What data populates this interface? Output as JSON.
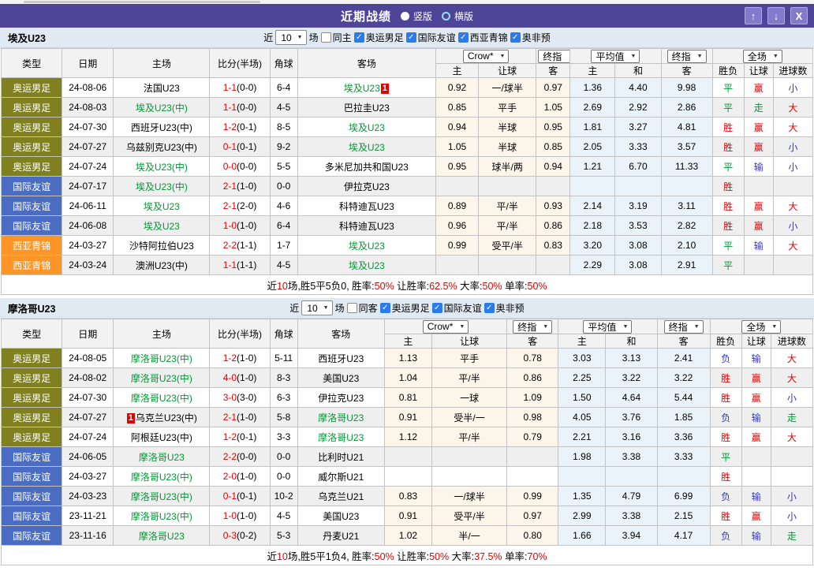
{
  "colors": {
    "titlebar_bg": "#4e4498",
    "button_bg": "#837acb",
    "section_bar_bg": "#e1eaf3",
    "team_green": "#009933",
    "score_red": "#e60000",
    "odds_bg": "#fcf5ea",
    "avg_bg": "#e9f3f9",
    "stripe_bg": "#efefef",
    "checkbox_blue": "#2b7cea",
    "type_colors": {
      "奥运男足": "#80801e",
      "国际友谊": "#4a6cc3",
      "西亚青锦": "#fd9627"
    },
    "result_colors": {
      "red": "#e60000",
      "green": "#009933",
      "blue": "#3434d0"
    }
  },
  "titlebar": {
    "title": "近期战绩",
    "vertical_label": "竖版",
    "horizontal_label": "横版",
    "up_button": "↑",
    "down_button": "↓",
    "close_button": "X"
  },
  "table_header": {
    "type": "类型",
    "date": "日期",
    "home": "主场",
    "score": "比分(半场)",
    "corner": "角球",
    "away": "客场",
    "odds_source": "Crow*",
    "odds_final": "终指",
    "avg_source": "平均值",
    "avg_final": "终指",
    "scope": "全场",
    "sub": [
      "主",
      "让球",
      "客",
      "主",
      "和",
      "客",
      "胜负",
      "让球",
      "进球数"
    ]
  },
  "result_color_map": {
    "胜": "red",
    "负": "blue",
    "平": "green",
    "赢": "red",
    "输": "blue",
    "走": "green",
    "大": "red",
    "小": "blue"
  },
  "sections": [
    {
      "team": "埃及U23",
      "filter": {
        "near": "近",
        "count": "10",
        "games": "场",
        "same_side": {
          "label": "同主",
          "checked": false
        },
        "competitions": [
          {
            "label": "奥运男足",
            "checked": true
          },
          {
            "label": "国际友谊",
            "checked": true
          },
          {
            "label": "西亚青锦",
            "checked": true
          },
          {
            "label": "奥非预",
            "checked": true
          }
        ]
      },
      "rows": [
        {
          "type": "奥运男足",
          "date": "24-08-06",
          "home": "法国U23",
          "home_green": false,
          "home_badge": "",
          "score": "1-1",
          "half": "(0-0)",
          "corner": "6-4",
          "away": "埃及U23",
          "away_green": true,
          "away_badge": "1",
          "odds": [
            "0.92",
            "一/球半",
            "0.97"
          ],
          "avg": [
            "1.36",
            "4.40",
            "9.98"
          ],
          "results": [
            "平",
            "赢",
            "小"
          ]
        },
        {
          "type": "奥运男足",
          "date": "24-08-03",
          "home": "埃及U23(中)",
          "home_green": true,
          "home_badge": "",
          "score": "1-1",
          "half": "(0-0)",
          "corner": "4-5",
          "away": "巴拉圭U23",
          "away_green": false,
          "away_badge": "",
          "odds": [
            "0.85",
            "平手",
            "1.05"
          ],
          "avg": [
            "2.69",
            "2.92",
            "2.86"
          ],
          "results": [
            "平",
            "走",
            "大"
          ]
        },
        {
          "type": "奥运男足",
          "date": "24-07-30",
          "home": "西班牙U23(中)",
          "home_green": false,
          "home_badge": "",
          "score": "1-2",
          "half": "(0-1)",
          "corner": "8-5",
          "away": "埃及U23",
          "away_green": true,
          "away_badge": "",
          "odds": [
            "0.94",
            "半球",
            "0.95"
          ],
          "avg": [
            "1.81",
            "3.27",
            "4.81"
          ],
          "results": [
            "胜",
            "赢",
            "大"
          ]
        },
        {
          "type": "奥运男足",
          "date": "24-07-27",
          "home": "乌兹别克U23(中)",
          "home_green": false,
          "home_badge": "",
          "score": "0-1",
          "half": "(0-1)",
          "corner": "9-2",
          "away": "埃及U23",
          "away_green": true,
          "away_badge": "",
          "odds": [
            "1.05",
            "半球",
            "0.85"
          ],
          "avg": [
            "2.05",
            "3.33",
            "3.57"
          ],
          "results": [
            "胜",
            "赢",
            "小"
          ]
        },
        {
          "type": "奥运男足",
          "date": "24-07-24",
          "home": "埃及U23(中)",
          "home_green": true,
          "home_badge": "",
          "score": "0-0",
          "half": "(0-0)",
          "corner": "5-5",
          "away": "多米尼加共和国U23",
          "away_green": false,
          "away_badge": "",
          "odds": [
            "0.95",
            "球半/两",
            "0.94"
          ],
          "avg": [
            "1.21",
            "6.70",
            "11.33"
          ],
          "results": [
            "平",
            "输",
            "小"
          ]
        },
        {
          "type": "国际友谊",
          "date": "24-07-17",
          "home": "埃及U23(中)",
          "home_green": true,
          "home_badge": "",
          "score": "2-1",
          "half": "(1-0)",
          "corner": "0-0",
          "away": "伊拉克U23",
          "away_green": false,
          "away_badge": "",
          "odds": [
            "",
            "",
            ""
          ],
          "avg": [
            "",
            "",
            ""
          ],
          "results": [
            "胜",
            "",
            ""
          ]
        },
        {
          "type": "国际友谊",
          "date": "24-06-11",
          "home": "埃及U23",
          "home_green": true,
          "home_badge": "",
          "score": "2-1",
          "half": "(2-0)",
          "corner": "4-6",
          "away": "科特迪瓦U23",
          "away_green": false,
          "away_badge": "",
          "odds": [
            "0.89",
            "平/半",
            "0.93"
          ],
          "avg": [
            "2.14",
            "3.19",
            "3.11"
          ],
          "results": [
            "胜",
            "赢",
            "大"
          ]
        },
        {
          "type": "国际友谊",
          "date": "24-06-08",
          "home": "埃及U23",
          "home_green": true,
          "home_badge": "",
          "score": "1-0",
          "half": "(1-0)",
          "corner": "6-4",
          "away": "科特迪瓦U23",
          "away_green": false,
          "away_badge": "",
          "odds": [
            "0.96",
            "平/半",
            "0.86"
          ],
          "avg": [
            "2.18",
            "3.53",
            "2.82"
          ],
          "results": [
            "胜",
            "赢",
            "小"
          ]
        },
        {
          "type": "西亚青锦",
          "date": "24-03-27",
          "home": "沙特阿拉伯U23",
          "home_green": false,
          "home_badge": "",
          "score": "2-2",
          "half": "(1-1)",
          "corner": "1-7",
          "away": "埃及U23",
          "away_green": true,
          "away_badge": "",
          "odds": [
            "0.99",
            "受平/半",
            "0.83"
          ],
          "avg": [
            "3.20",
            "3.08",
            "2.10"
          ],
          "results": [
            "平",
            "输",
            "大"
          ]
        },
        {
          "type": "西亚青锦",
          "date": "24-03-24",
          "home": "澳洲U23(中)",
          "home_green": false,
          "home_badge": "",
          "score": "1-1",
          "half": "(1-1)",
          "corner": "4-5",
          "away": "埃及U23",
          "away_green": true,
          "away_badge": "",
          "odds": [
            "",
            "",
            ""
          ],
          "avg": [
            "2.29",
            "3.08",
            "2.91"
          ],
          "results": [
            "平",
            "",
            ""
          ]
        }
      ],
      "summary": [
        {
          "t": "近",
          "red": false
        },
        {
          "t": "10",
          "red": true
        },
        {
          "t": "场,胜5平5负0, 胜率:",
          "red": false
        },
        {
          "t": "50%",
          "red": true
        },
        {
          "t": " 让胜率:",
          "red": false
        },
        {
          "t": "62.5%",
          "red": true
        },
        {
          "t": " 大率:",
          "red": false
        },
        {
          "t": "50%",
          "red": true
        },
        {
          "t": " 单率:",
          "red": false
        },
        {
          "t": "50%",
          "red": true
        }
      ]
    },
    {
      "team": "摩洛哥U23",
      "filter": {
        "near": "近",
        "count": "10",
        "games": "场",
        "same_side": {
          "label": "同客",
          "checked": false
        },
        "competitions": [
          {
            "label": "奥运男足",
            "checked": true
          },
          {
            "label": "国际友谊",
            "checked": true
          },
          {
            "label": "奥非预",
            "checked": true
          }
        ]
      },
      "rows": [
        {
          "type": "奥运男足",
          "date": "24-08-05",
          "home": "摩洛哥U23(中)",
          "home_green": true,
          "home_badge": "",
          "score": "1-2",
          "half": "(1-0)",
          "corner": "5-11",
          "away": "西班牙U23",
          "away_green": false,
          "away_badge": "",
          "odds": [
            "1.13",
            "平手",
            "0.78"
          ],
          "avg": [
            "3.03",
            "3.13",
            "2.41"
          ],
          "results": [
            "负",
            "输",
            "大"
          ]
        },
        {
          "type": "奥运男足",
          "date": "24-08-02",
          "home": "摩洛哥U23(中)",
          "home_green": true,
          "home_badge": "",
          "score": "4-0",
          "half": "(1-0)",
          "corner": "8-3",
          "away": "美国U23",
          "away_green": false,
          "away_badge": "",
          "odds": [
            "1.04",
            "平/半",
            "0.86"
          ],
          "avg": [
            "2.25",
            "3.22",
            "3.22"
          ],
          "results": [
            "胜",
            "赢",
            "大"
          ]
        },
        {
          "type": "奥运男足",
          "date": "24-07-30",
          "home": "摩洛哥U23(中)",
          "home_green": true,
          "home_badge": "",
          "score": "3-0",
          "half": "(3-0)",
          "corner": "6-3",
          "away": "伊拉克U23",
          "away_green": false,
          "away_badge": "",
          "odds": [
            "0.81",
            "一球",
            "1.09"
          ],
          "avg": [
            "1.50",
            "4.64",
            "5.44"
          ],
          "results": [
            "胜",
            "赢",
            "小"
          ]
        },
        {
          "type": "奥运男足",
          "date": "24-07-27",
          "home": "乌克兰U23(中)",
          "home_green": false,
          "home_badge": "1",
          "score": "2-1",
          "half": "(1-0)",
          "corner": "5-8",
          "away": "摩洛哥U23",
          "away_green": true,
          "away_badge": "",
          "odds": [
            "0.91",
            "受半/一",
            "0.98"
          ],
          "avg": [
            "4.05",
            "3.76",
            "1.85"
          ],
          "results": [
            "负",
            "输",
            "走"
          ]
        },
        {
          "type": "奥运男足",
          "date": "24-07-24",
          "home": "阿根廷U23(中)",
          "home_green": false,
          "home_badge": "",
          "score": "1-2",
          "half": "(0-1)",
          "corner": "3-3",
          "away": "摩洛哥U23",
          "away_green": true,
          "away_badge": "",
          "odds": [
            "1.12",
            "平/半",
            "0.79"
          ],
          "avg": [
            "2.21",
            "3.16",
            "3.36"
          ],
          "results": [
            "胜",
            "赢",
            "大"
          ]
        },
        {
          "type": "国际友谊",
          "date": "24-06-05",
          "home": "摩洛哥U23",
          "home_green": true,
          "home_badge": "",
          "score": "2-2",
          "half": "(0-0)",
          "corner": "0-0",
          "away": "比利时U21",
          "away_green": false,
          "away_badge": "",
          "odds": [
            "",
            "",
            ""
          ],
          "avg": [
            "1.98",
            "3.38",
            "3.33"
          ],
          "results": [
            "平",
            "",
            ""
          ]
        },
        {
          "type": "国际友谊",
          "date": "24-03-27",
          "home": "摩洛哥U23(中)",
          "home_green": true,
          "home_badge": "",
          "score": "2-0",
          "half": "(1-0)",
          "corner": "0-0",
          "away": "威尔斯U21",
          "away_green": false,
          "away_badge": "",
          "odds": [
            "",
            "",
            ""
          ],
          "avg": [
            "",
            "",
            ""
          ],
          "results": [
            "胜",
            "",
            ""
          ]
        },
        {
          "type": "国际友谊",
          "date": "24-03-23",
          "home": "摩洛哥U23(中)",
          "home_green": true,
          "home_badge": "",
          "score": "0-1",
          "half": "(0-1)",
          "corner": "10-2",
          "away": "乌克兰U21",
          "away_green": false,
          "away_badge": "",
          "odds": [
            "0.83",
            "一/球半",
            "0.99"
          ],
          "avg": [
            "1.35",
            "4.79",
            "6.99"
          ],
          "results": [
            "负",
            "输",
            "小"
          ]
        },
        {
          "type": "国际友谊",
          "date": "23-11-21",
          "home": "摩洛哥U23(中)",
          "home_green": true,
          "home_badge": "",
          "score": "1-0",
          "half": "(1-0)",
          "corner": "4-5",
          "away": "美国U23",
          "away_green": false,
          "away_badge": "",
          "odds": [
            "0.91",
            "受平/半",
            "0.97"
          ],
          "avg": [
            "2.99",
            "3.38",
            "2.15"
          ],
          "results": [
            "胜",
            "赢",
            "小"
          ]
        },
        {
          "type": "国际友谊",
          "date": "23-11-16",
          "home": "摩洛哥U23",
          "home_green": true,
          "home_badge": "",
          "score": "0-3",
          "half": "(0-2)",
          "corner": "5-3",
          "away": "丹麦U21",
          "away_green": false,
          "away_badge": "",
          "odds": [
            "1.02",
            "半/一",
            "0.80"
          ],
          "avg": [
            "1.66",
            "3.94",
            "4.17"
          ],
          "results": [
            "负",
            "输",
            "走"
          ]
        }
      ],
      "summary": [
        {
          "t": "近",
          "red": false
        },
        {
          "t": "10",
          "red": true
        },
        {
          "t": "场,胜5平1负4, 胜率:",
          "red": false
        },
        {
          "t": "50%",
          "red": true
        },
        {
          "t": " 让胜率:",
          "red": false
        },
        {
          "t": "50%",
          "red": true
        },
        {
          "t": " 大率:",
          "red": false
        },
        {
          "t": "37.5%",
          "red": true
        },
        {
          "t": " 单率:",
          "red": false
        },
        {
          "t": "70%",
          "red": true
        }
      ]
    }
  ]
}
